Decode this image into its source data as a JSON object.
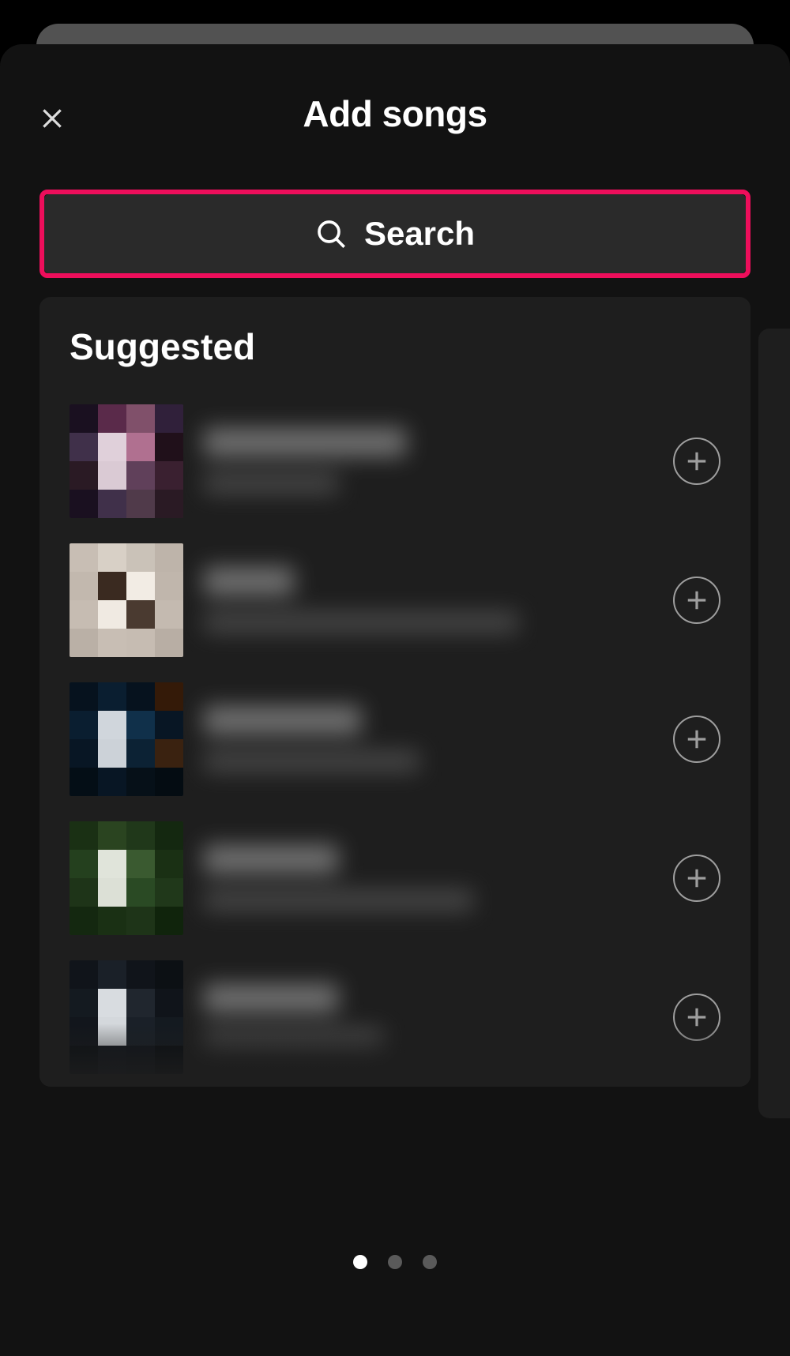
{
  "header": {
    "title": "Add songs"
  },
  "search": {
    "label": "Search"
  },
  "section": {
    "title": "Suggested"
  },
  "highlight_color": "#ED0E5B",
  "pagination": {
    "count": 3,
    "active_index": 0
  },
  "songs": [
    {
      "title": "",
      "subtitle": "",
      "art_palette": "p-a"
    },
    {
      "title": "",
      "subtitle": "",
      "art_palette": "p-b"
    },
    {
      "title": "",
      "subtitle": "",
      "art_palette": "p-c"
    },
    {
      "title": "",
      "subtitle": "",
      "art_palette": "p-d"
    },
    {
      "title": "",
      "subtitle": "",
      "art_palette": "p-e"
    }
  ]
}
